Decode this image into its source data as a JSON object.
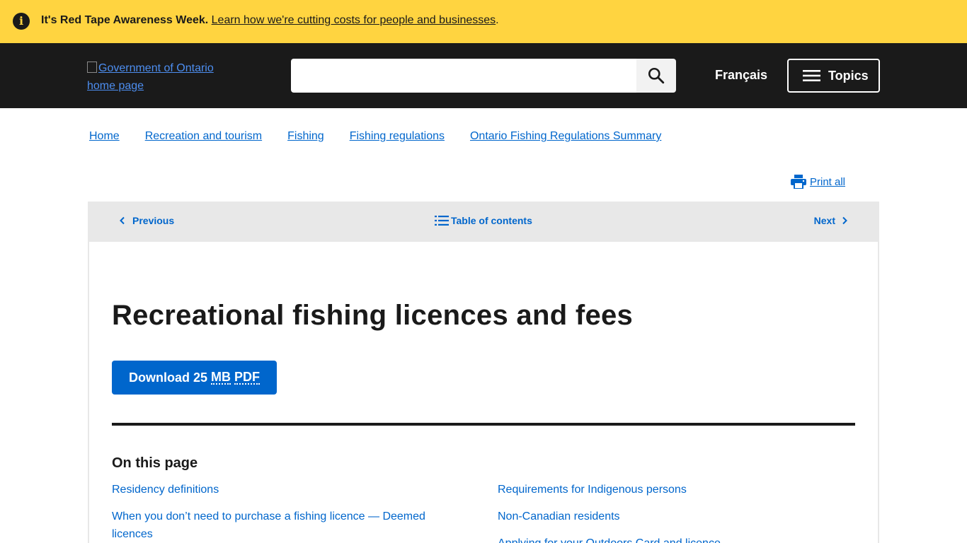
{
  "alert": {
    "icon": "info-icon",
    "bold": "It's Red Tape Awareness Week.",
    "link": "Learn how we're cutting costs for people and businesses",
    "suffix": "."
  },
  "header": {
    "logo_alt": "Government of Ontario home page",
    "search_placeholder": "",
    "search_icon": "search-icon",
    "language": "Français",
    "topics": "Topics"
  },
  "breadcrumbs": [
    "Home",
    "Recreation and tourism",
    "Fishing",
    "Fishing regulations",
    "Ontario Fishing Regulations Summary"
  ],
  "print_all": "Print all",
  "nav": {
    "previous": "Previous",
    "toc": "Table of contents",
    "next": "Next"
  },
  "main": {
    "title": "Recreational fishing licences and fees",
    "download_prefix": "Download 25 ",
    "download_mb": "MB",
    "download_pdf": "PDF",
    "on_this_page": "On this page",
    "links_left": [
      "Residency definitions",
      "When you don’t need to purchase a fishing licence — Deemed licences"
    ],
    "links_right": [
      "Requirements for Indigenous persons",
      "Non-Canadian residents",
      "Applying for your Outdoors Card and licence"
    ]
  },
  "colors": {
    "alert_bg": "#ffd440",
    "header_bg": "#1a1a1a",
    "link": "#0066cc",
    "nav_bg": "#e8e8e8"
  }
}
